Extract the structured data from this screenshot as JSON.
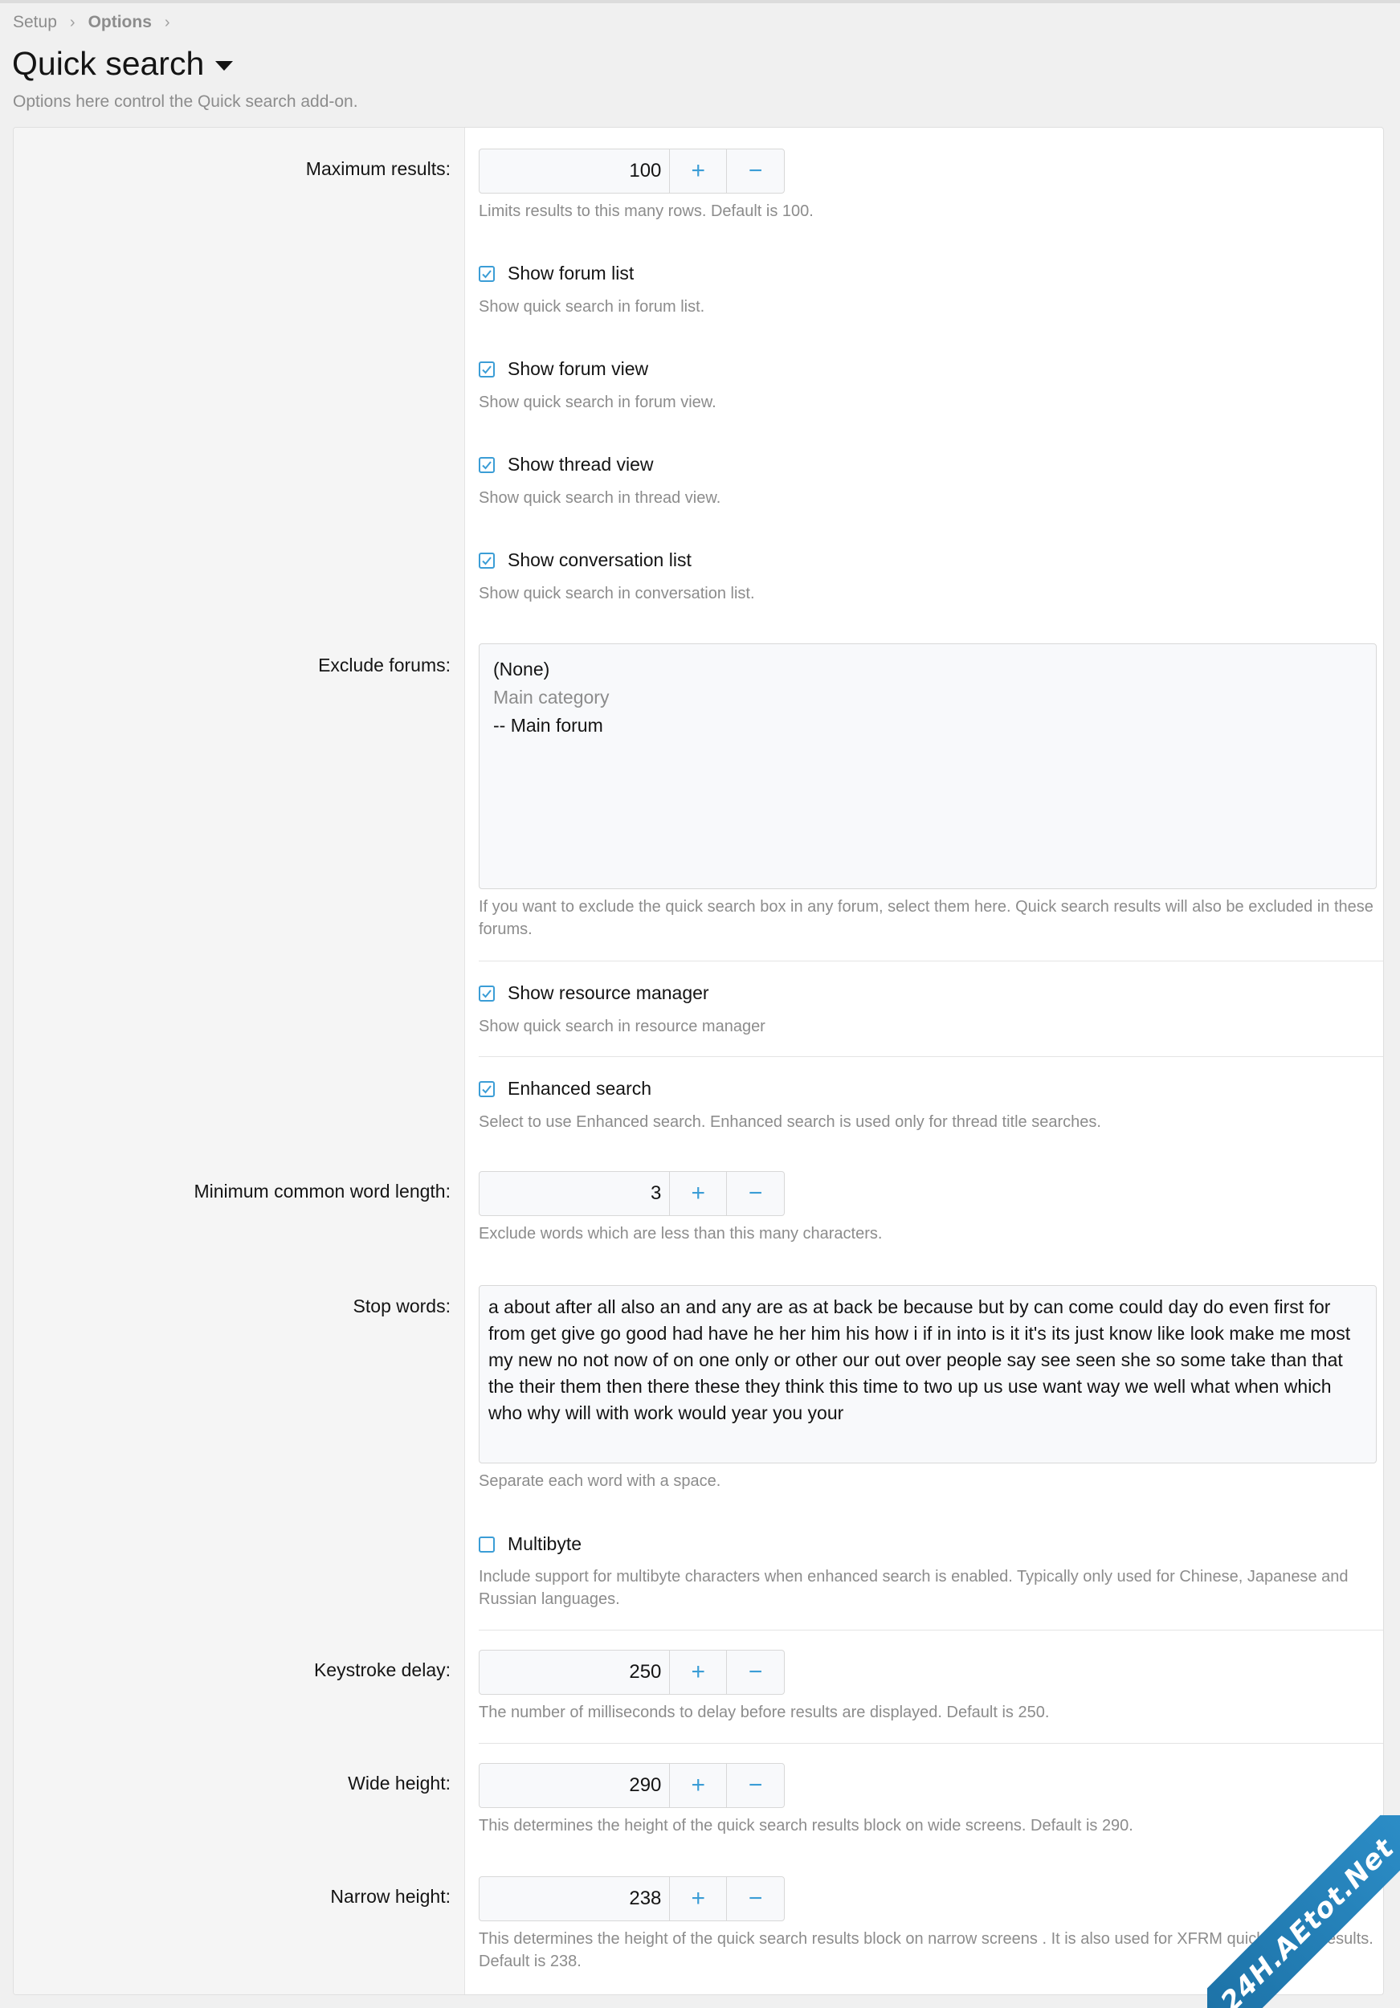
{
  "breadcrumb": {
    "items": [
      "Setup",
      "Options"
    ]
  },
  "page": {
    "title": "Quick search",
    "description": "Options here control the Quick search add-on."
  },
  "options": {
    "max_results": {
      "label": "Maximum results:",
      "value": "100",
      "hint": "Limits results to this many rows. Default is 100."
    },
    "show_forum_list": {
      "label": "Show forum list",
      "checked": true,
      "hint": "Show quick search in forum list."
    },
    "show_forum_view": {
      "label": "Show forum view",
      "checked": true,
      "hint": "Show quick search in forum view."
    },
    "show_thread_view": {
      "label": "Show thread view",
      "checked": true,
      "hint": "Show quick search in thread view."
    },
    "show_conversation_list": {
      "label": "Show conversation list",
      "checked": true,
      "hint": "Show quick search in conversation list."
    },
    "exclude_forums": {
      "label": "Exclude forums:",
      "options": [
        "(None)",
        "Main category",
        "-- Main forum"
      ],
      "hint": "If you want to exclude the quick search box in any forum, select them here. Quick search results will also be excluded in these forums."
    },
    "show_resource_manager": {
      "label": "Show resource manager",
      "checked": true,
      "hint": "Show quick search in resource manager"
    },
    "enhanced_search": {
      "label": "Enhanced search",
      "checked": true,
      "hint": "Select to use Enhanced search. Enhanced search is used only for thread title searches."
    },
    "min_word_length": {
      "label": "Minimum common word length:",
      "value": "3",
      "hint": "Exclude words which are less than this many characters."
    },
    "stop_words": {
      "label": "Stop words:",
      "value": "a about after all also an and any are as at back be because but by can come could day do even first for from get give go good had have he her him his how i if in into is it it's its just know like look make me most my new no not now of on one only or other our out over people say see seen she so some take than that the their them then there these they think this time to two up us use want way we well what when which who why will with work would year you your",
      "hint": "Separate each word with a space."
    },
    "multibyte": {
      "label": "Multibyte",
      "checked": false,
      "hint": "Include support for multibyte characters when enhanced search is enabled. Typically only used for Chinese, Japanese and Russian languages."
    },
    "keystroke_delay": {
      "label": "Keystroke delay:",
      "value": "250",
      "hint": "The number of milliseconds to delay before results are displayed. Default is 250."
    },
    "wide_height": {
      "label": "Wide height:",
      "value": "290",
      "hint": "This determines the height of the quick search results block on wide screens. Default is 290."
    },
    "narrow_height": {
      "label": "Narrow height:",
      "value": "238",
      "hint": "This determines the height of the quick search results block on narrow screens . It is also used for XFRM quick search results. Default is 238."
    }
  },
  "controls": {
    "plus": "+",
    "minus": "−"
  },
  "watermark": {
    "text": "24H.AEtot.Net"
  },
  "colors": {
    "accent": "#3b9dd6",
    "hint": "#8c8c8c",
    "label_column_bg": "#f5f5f5"
  }
}
